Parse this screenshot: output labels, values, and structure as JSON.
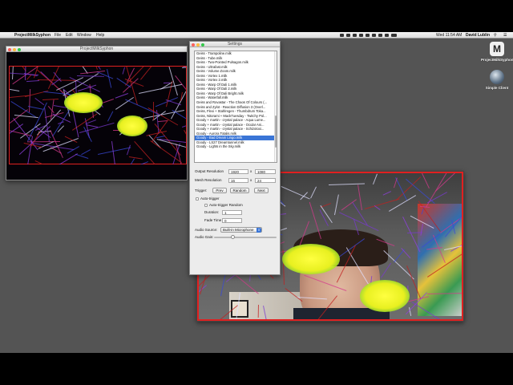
{
  "menubar": {
    "app_name": "ProjectMilkSyphon",
    "menus": [
      "File",
      "Edit",
      "Window",
      "Help"
    ],
    "clock": "Wed 11:54 AM",
    "user": "David Lublin"
  },
  "desktop_icons": [
    {
      "label": "ProjectMilkSyphon",
      "icon": "projectmilksyphon-app-icon"
    },
    {
      "label": "Simple Client",
      "icon": "simple-client-app-icon"
    }
  ],
  "output_window": {
    "title": "ProjectMilkSyphon"
  },
  "settings": {
    "title": "Settings",
    "presets": [
      "Geiss - Trampoline.milk",
      "Geiss - Tube.milk",
      "Geiss - Two-Pointed Pulsagon.milk",
      "Geiss - Ultrafast.milk",
      "Geiss - Volume Zoom.milk",
      "Geiss - Vortex 1.milk",
      "Geiss - Vortex 2.milk",
      "Geiss - Warp Of Dali 1.milk",
      "Geiss - Warp Of Dali 2.milk",
      "Geiss - Warp Of Dali Bright.milk",
      "Geiss - Waterfall.milk",
      "Geiss and Rovastar - The Chaos Of Colours (...",
      "Geiss and Zylot - Reaction Diffusion 3 (Overl...",
      "Geiss, Flexi + Stahlregen - Thumbdrum Toka...",
      "Geiss, Nitorami + MackTuesday - Twitchy Pol...",
      "Goody + martin - crystal palace - Aqua Lume...",
      "Goody + martin - crystal palace - Ocular Ani...",
      "Goody + martin - crystal palace - Schizotoxi...",
      "Goody - Aurora Totalis.milk",
      "Goody - Bad Dream Lingo.milk",
      "Goody - LS27 Dreamtunnel.milk",
      "Goody - Lights in the Sky.milk"
    ],
    "selected_index": 19,
    "output_resolution_label": "Output Resolution",
    "output_width": "1920",
    "output_height": "1080",
    "mesh_resolution_label": "Mesh Resolution",
    "mesh_width": "16",
    "mesh_height": "24",
    "times": "x",
    "trigger_label": "Trigger:",
    "prev": "Prev",
    "random": "Random",
    "next": "Next",
    "auto_trigger": "Auto-trigger",
    "auto_trigger_random": "Auto-trigger Random",
    "duration_label": "Duration:",
    "duration_value": "1",
    "fade_label": "Fade Time",
    "fade_value": "0",
    "audio_source_label": "Audio Source:",
    "audio_source_value": "Built-in Microphone",
    "audio_gain_label": "Audio Gain:",
    "audio_gain_fraction": 0.3
  },
  "colors": {
    "desktop": "#545454",
    "selection": "#3a75d6",
    "frame_red": "#e02020",
    "blob_yellow": "#ffff40"
  }
}
